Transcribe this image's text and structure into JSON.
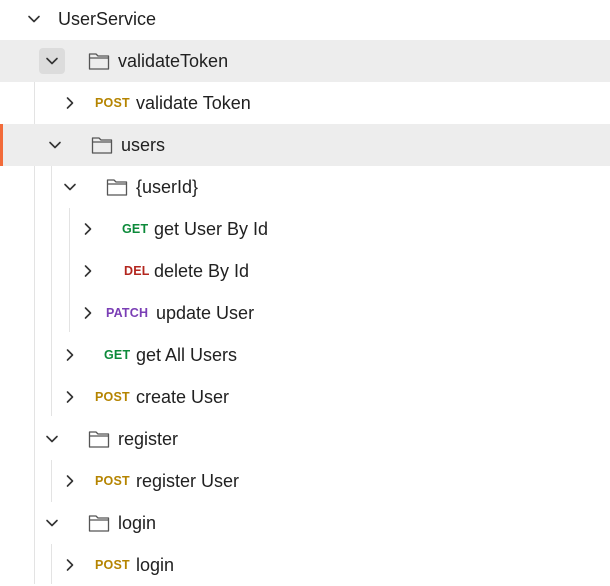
{
  "tree": {
    "root": "UserService",
    "colors": {
      "POST": "#b58400",
      "GET": "#0c8a3a",
      "DEL": "#b3261e",
      "PATCH": "#7a3eb5",
      "highlight_bg": "#ededed",
      "active_indicator": "#f26b3a"
    },
    "items": [
      {
        "type": "folder",
        "label": "validateToken",
        "expanded": true
      },
      {
        "type": "request",
        "method": "POST",
        "label": "validate Token"
      },
      {
        "type": "folder",
        "label": "users",
        "expanded": true
      },
      {
        "type": "folder",
        "label": "{userId}",
        "expanded": true
      },
      {
        "type": "request",
        "method": "GET",
        "label": "get User By Id"
      },
      {
        "type": "request",
        "method": "DEL",
        "label": "delete By Id"
      },
      {
        "type": "request",
        "method": "PATCH",
        "label": "update User"
      },
      {
        "type": "request",
        "method": "GET",
        "label": "get All Users"
      },
      {
        "type": "request",
        "method": "POST",
        "label": "create User"
      },
      {
        "type": "folder",
        "label": "register",
        "expanded": true
      },
      {
        "type": "request",
        "method": "POST",
        "label": "register User"
      },
      {
        "type": "folder",
        "label": "login",
        "expanded": true
      },
      {
        "type": "request",
        "method": "POST",
        "label": "login"
      }
    ]
  }
}
